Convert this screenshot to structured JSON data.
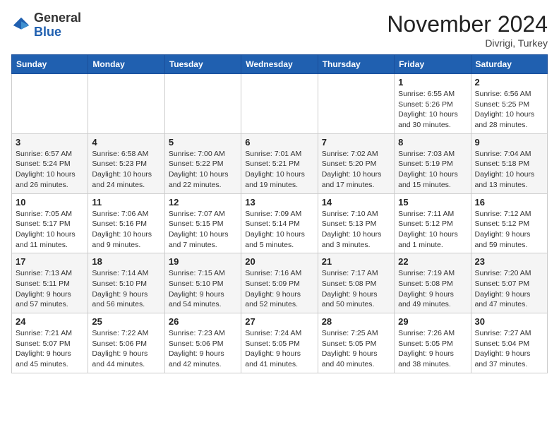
{
  "header": {
    "logo_general": "General",
    "logo_blue": "Blue",
    "month_title": "November 2024",
    "location": "Divrigi, Turkey"
  },
  "weekdays": [
    "Sunday",
    "Monday",
    "Tuesday",
    "Wednesday",
    "Thursday",
    "Friday",
    "Saturday"
  ],
  "weeks": [
    [
      {
        "day": "",
        "info": ""
      },
      {
        "day": "",
        "info": ""
      },
      {
        "day": "",
        "info": ""
      },
      {
        "day": "",
        "info": ""
      },
      {
        "day": "",
        "info": ""
      },
      {
        "day": "1",
        "info": "Sunrise: 6:55 AM\nSunset: 5:26 PM\nDaylight: 10 hours and 30 minutes."
      },
      {
        "day": "2",
        "info": "Sunrise: 6:56 AM\nSunset: 5:25 PM\nDaylight: 10 hours and 28 minutes."
      }
    ],
    [
      {
        "day": "3",
        "info": "Sunrise: 6:57 AM\nSunset: 5:24 PM\nDaylight: 10 hours and 26 minutes."
      },
      {
        "day": "4",
        "info": "Sunrise: 6:58 AM\nSunset: 5:23 PM\nDaylight: 10 hours and 24 minutes."
      },
      {
        "day": "5",
        "info": "Sunrise: 7:00 AM\nSunset: 5:22 PM\nDaylight: 10 hours and 22 minutes."
      },
      {
        "day": "6",
        "info": "Sunrise: 7:01 AM\nSunset: 5:21 PM\nDaylight: 10 hours and 19 minutes."
      },
      {
        "day": "7",
        "info": "Sunrise: 7:02 AM\nSunset: 5:20 PM\nDaylight: 10 hours and 17 minutes."
      },
      {
        "day": "8",
        "info": "Sunrise: 7:03 AM\nSunset: 5:19 PM\nDaylight: 10 hours and 15 minutes."
      },
      {
        "day": "9",
        "info": "Sunrise: 7:04 AM\nSunset: 5:18 PM\nDaylight: 10 hours and 13 minutes."
      }
    ],
    [
      {
        "day": "10",
        "info": "Sunrise: 7:05 AM\nSunset: 5:17 PM\nDaylight: 10 hours and 11 minutes."
      },
      {
        "day": "11",
        "info": "Sunrise: 7:06 AM\nSunset: 5:16 PM\nDaylight: 10 hours and 9 minutes."
      },
      {
        "day": "12",
        "info": "Sunrise: 7:07 AM\nSunset: 5:15 PM\nDaylight: 10 hours and 7 minutes."
      },
      {
        "day": "13",
        "info": "Sunrise: 7:09 AM\nSunset: 5:14 PM\nDaylight: 10 hours and 5 minutes."
      },
      {
        "day": "14",
        "info": "Sunrise: 7:10 AM\nSunset: 5:13 PM\nDaylight: 10 hours and 3 minutes."
      },
      {
        "day": "15",
        "info": "Sunrise: 7:11 AM\nSunset: 5:12 PM\nDaylight: 10 hours and 1 minute."
      },
      {
        "day": "16",
        "info": "Sunrise: 7:12 AM\nSunset: 5:12 PM\nDaylight: 9 hours and 59 minutes."
      }
    ],
    [
      {
        "day": "17",
        "info": "Sunrise: 7:13 AM\nSunset: 5:11 PM\nDaylight: 9 hours and 57 minutes."
      },
      {
        "day": "18",
        "info": "Sunrise: 7:14 AM\nSunset: 5:10 PM\nDaylight: 9 hours and 56 minutes."
      },
      {
        "day": "19",
        "info": "Sunrise: 7:15 AM\nSunset: 5:10 PM\nDaylight: 9 hours and 54 minutes."
      },
      {
        "day": "20",
        "info": "Sunrise: 7:16 AM\nSunset: 5:09 PM\nDaylight: 9 hours and 52 minutes."
      },
      {
        "day": "21",
        "info": "Sunrise: 7:17 AM\nSunset: 5:08 PM\nDaylight: 9 hours and 50 minutes."
      },
      {
        "day": "22",
        "info": "Sunrise: 7:19 AM\nSunset: 5:08 PM\nDaylight: 9 hours and 49 minutes."
      },
      {
        "day": "23",
        "info": "Sunrise: 7:20 AM\nSunset: 5:07 PM\nDaylight: 9 hours and 47 minutes."
      }
    ],
    [
      {
        "day": "24",
        "info": "Sunrise: 7:21 AM\nSunset: 5:07 PM\nDaylight: 9 hours and 45 minutes."
      },
      {
        "day": "25",
        "info": "Sunrise: 7:22 AM\nSunset: 5:06 PM\nDaylight: 9 hours and 44 minutes."
      },
      {
        "day": "26",
        "info": "Sunrise: 7:23 AM\nSunset: 5:06 PM\nDaylight: 9 hours and 42 minutes."
      },
      {
        "day": "27",
        "info": "Sunrise: 7:24 AM\nSunset: 5:05 PM\nDaylight: 9 hours and 41 minutes."
      },
      {
        "day": "28",
        "info": "Sunrise: 7:25 AM\nSunset: 5:05 PM\nDaylight: 9 hours and 40 minutes."
      },
      {
        "day": "29",
        "info": "Sunrise: 7:26 AM\nSunset: 5:05 PM\nDaylight: 9 hours and 38 minutes."
      },
      {
        "day": "30",
        "info": "Sunrise: 7:27 AM\nSunset: 5:04 PM\nDaylight: 9 hours and 37 minutes."
      }
    ]
  ]
}
